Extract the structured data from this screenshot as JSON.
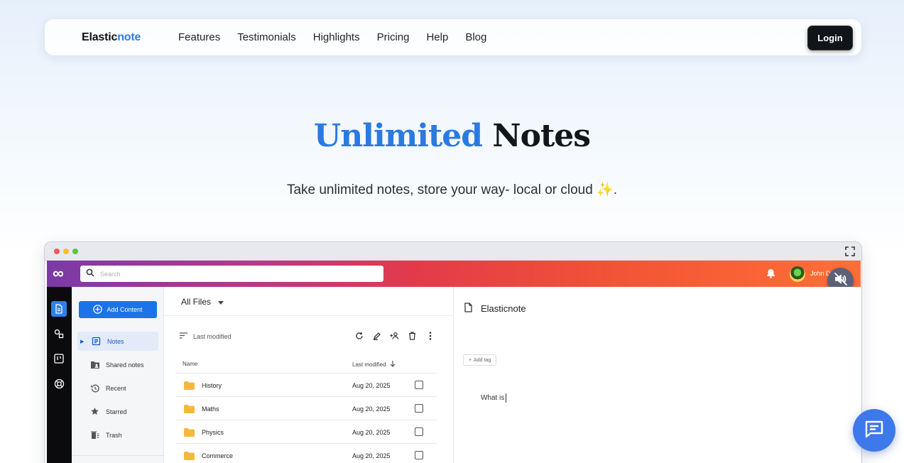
{
  "nav": {
    "brand_main": "Elastic",
    "brand_accent": "note",
    "links": [
      "Features",
      "Testimonials",
      "Highlights",
      "Pricing",
      "Help",
      "Blog"
    ],
    "login_label": "Login"
  },
  "hero": {
    "title_accent": "Unlimited",
    "title_rest": "Notes",
    "subtitle": "Take unlimited notes, store your way- local or cloud ✨."
  },
  "app": {
    "logo_glyph": "∞",
    "search_placeholder": "Search",
    "user_name": "John D",
    "sidebar": {
      "add_label": "Add Content",
      "items": [
        {
          "label": "Notes",
          "icon": "notes-icon",
          "active": true
        },
        {
          "label": "Shared notes",
          "icon": "shared-folder-icon",
          "active": false
        },
        {
          "label": "Recent",
          "icon": "history-icon",
          "active": false
        },
        {
          "label": "Starred",
          "icon": "star-icon",
          "active": false
        },
        {
          "label": "Trash",
          "icon": "trash-icon",
          "active": false
        }
      ]
    },
    "files": {
      "location": "All Files",
      "sort_label": "Last modified",
      "columns": [
        "Name",
        "Last modified"
      ],
      "rows": [
        {
          "name": "History",
          "date": "Aug 20, 2025"
        },
        {
          "name": "Maths",
          "date": "Aug 20, 2025"
        },
        {
          "name": "Physics",
          "date": "Aug 20, 2025"
        },
        {
          "name": "Commerce",
          "date": "Aug 20, 2025"
        }
      ]
    },
    "editor": {
      "title": "Elasticnote",
      "add_tag_label": "Add tag",
      "body_text": "What is"
    }
  },
  "colors": {
    "accent_blue": "#2a7ae2",
    "gradient_start": "#7a3aa6",
    "gradient_end": "#ff6f36",
    "button_primary": "#1a73e8"
  }
}
